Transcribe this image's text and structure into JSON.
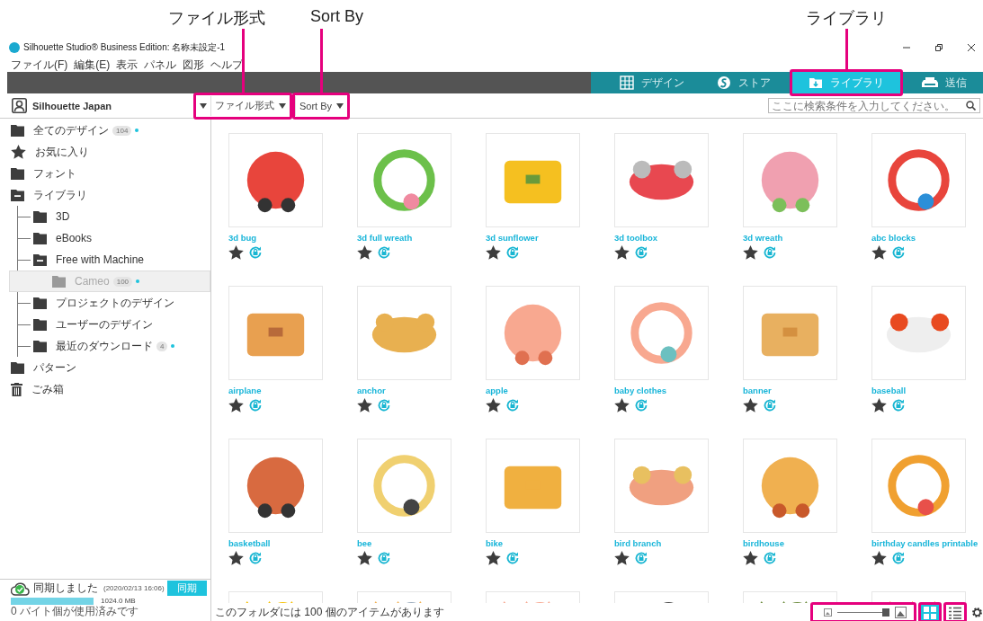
{
  "window": {
    "title": "Silhouette Studio® Business Edition: 名称未設定-1"
  },
  "menu": [
    "ファイル(F)",
    "編集(E)",
    "表示",
    "パネル",
    "図形",
    "ヘルプ"
  ],
  "tabs": [
    {
      "label": "デザイン",
      "selected": false,
      "highlighted": false
    },
    {
      "label": "ストア",
      "selected": false,
      "highlighted": false
    },
    {
      "label": "ライブラリ",
      "selected": true,
      "highlighted": true,
      "callout": "ライブラリ"
    },
    {
      "label": "送信",
      "selected": false,
      "highlighted": false
    }
  ],
  "user": {
    "name": "Silhouette Japan"
  },
  "filters": [
    {
      "label": "ファイル形式",
      "highlighted": true,
      "callout": "ファイル形式"
    },
    {
      "label": "Sort By",
      "highlighted": true,
      "callout": "Sort By"
    }
  ],
  "search": {
    "placeholder": "ここに検索条件を入力してください。"
  },
  "tree": [
    {
      "label": "全てのデザイン",
      "kind": "folder",
      "count": "104",
      "updated": true,
      "selected": false
    },
    {
      "label": "お気に入り",
      "kind": "star",
      "selected": false
    },
    {
      "label": "フォント",
      "kind": "folder",
      "selected": false
    },
    {
      "label": "ライブラリ",
      "kind": "folder",
      "expanded": true,
      "selected": false,
      "children": [
        {
          "label": "3D",
          "kind": "folder",
          "selected": false
        },
        {
          "label": "eBooks",
          "kind": "folder",
          "selected": false
        },
        {
          "label": "Free with Machine",
          "kind": "folder",
          "expanded": true,
          "selected": false,
          "children": [
            {
              "label": "Cameo",
              "kind": "folder",
              "count": "100",
              "updated": true,
              "selected": true
            }
          ]
        },
        {
          "label": "プロジェクトのデザイン",
          "kind": "folder",
          "selected": false
        },
        {
          "label": "ユーザーのデザイン",
          "kind": "folder",
          "selected": false
        },
        {
          "label": "最近のダウンロード",
          "kind": "folder",
          "count": "4",
          "updated": true,
          "selected": false
        }
      ]
    },
    {
      "label": "パターン",
      "kind": "folder",
      "selected": false
    },
    {
      "label": "ごみ箱",
      "kind": "trash",
      "selected": false
    }
  ],
  "designs": [
    {
      "name": "3d bug"
    },
    {
      "name": "3d full wreath"
    },
    {
      "name": "3d sunflower"
    },
    {
      "name": "3d toolbox"
    },
    {
      "name": "3d wreath"
    },
    {
      "name": "abc blocks"
    },
    {
      "name": "airplane"
    },
    {
      "name": "anchor"
    },
    {
      "name": "apple"
    },
    {
      "name": "baby clothes"
    },
    {
      "name": "banner"
    },
    {
      "name": "baseball"
    },
    {
      "name": "basketball"
    },
    {
      "name": "bee"
    },
    {
      "name": "bike"
    },
    {
      "name": "bird branch"
    },
    {
      "name": "birdhouse"
    },
    {
      "name": "birthday candles printable"
    },
    {
      "kind": "picture"
    },
    {
      "kind": "picture"
    },
    {
      "kind": "picture"
    },
    {
      "kind": "picture"
    },
    {
      "kind": "picture"
    },
    {
      "kind": "picture"
    }
  ],
  "sync": {
    "status": "同期しました",
    "time": "(2020/02/13 16:06)",
    "button": "同期"
  },
  "storage": {
    "level": 1,
    "size": "1024.0 MB",
    "used": "0 バイト個が使用済みです"
  },
  "status_bar": {
    "text": "このフォルダには 100 個のアイテムがあります"
  },
  "zoom_slider": {
    "level": 1,
    "highlighted": true
  },
  "view_buttons": [
    {
      "kind": "grid",
      "selected": true,
      "highlighted": true
    },
    {
      "kind": "list",
      "selected": false,
      "highlighted": true
    }
  ]
}
